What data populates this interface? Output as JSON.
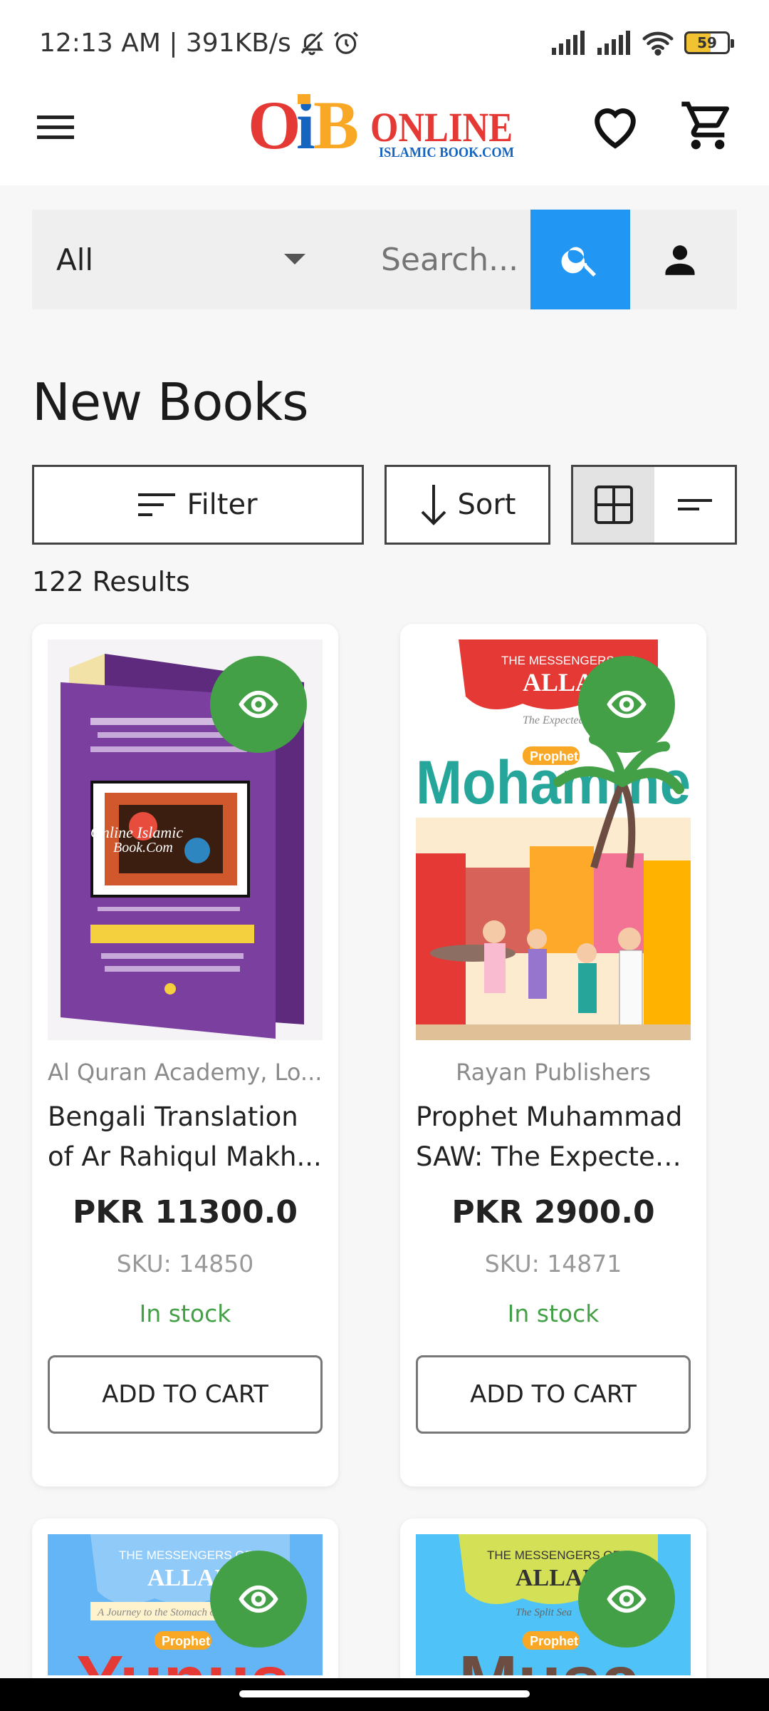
{
  "status": {
    "time_speed": "12:13 AM | 391KB/s",
    "battery": "59"
  },
  "header": {
    "logo_main": "OiB",
    "logo_text": "ONLINE",
    "logo_sub": "ISLAMIC BOOK.COM",
    "menu_icon": "hamburger-menu-icon",
    "wishlist_icon": "heart-icon",
    "cart_icon": "shopping-cart-icon"
  },
  "search": {
    "category": "All",
    "placeholder": "Search...",
    "accent": "#2196f3"
  },
  "page": {
    "title": "New Books",
    "filter_label": "Filter",
    "sort_label": "Sort",
    "results": "122 Results"
  },
  "products": [
    {
      "publisher": "Al Quran Academy, Lo...",
      "title_line1": "Bengali Translation",
      "title_line2": "of Ar Rahiqul Makh...",
      "price": "PKR 11300.0",
      "sku": "SKU: 14850",
      "stock": "In stock",
      "add_label": "ADD TO CART",
      "cover_watermark_1": "Online Islamic",
      "cover_watermark_2": "Book.Com"
    },
    {
      "publisher": "Rayan Publishers",
      "title_line1": "Prophet Muhammad",
      "title_line2": "SAW: The Expected...",
      "price": "PKR 2900.0",
      "sku": "SKU: 14871",
      "stock": "In stock",
      "add_label": "ADD TO CART",
      "cover_series": "THE MESSENGERS OF",
      "cover_allah": "ALLAH",
      "cover_subtitle": "The Expected Sa",
      "cover_badge": "Prophet",
      "cover_name": "Mohamme"
    },
    {
      "cover_series": "THE MESSENGERS OF",
      "cover_allah": "ALLAH",
      "cover_subtitle": "A Journey to the Stomach of",
      "cover_badge": "Prophet",
      "cover_name": "Yunus"
    },
    {
      "cover_series": "THE MESSENGERS OF",
      "cover_allah": "ALLAH",
      "cover_subtitle": "The Split Sea",
      "cover_badge": "Prophet",
      "cover_name": "Musa"
    }
  ],
  "colors": {
    "stock_green": "#43a047",
    "eye_button": "#43a047"
  }
}
